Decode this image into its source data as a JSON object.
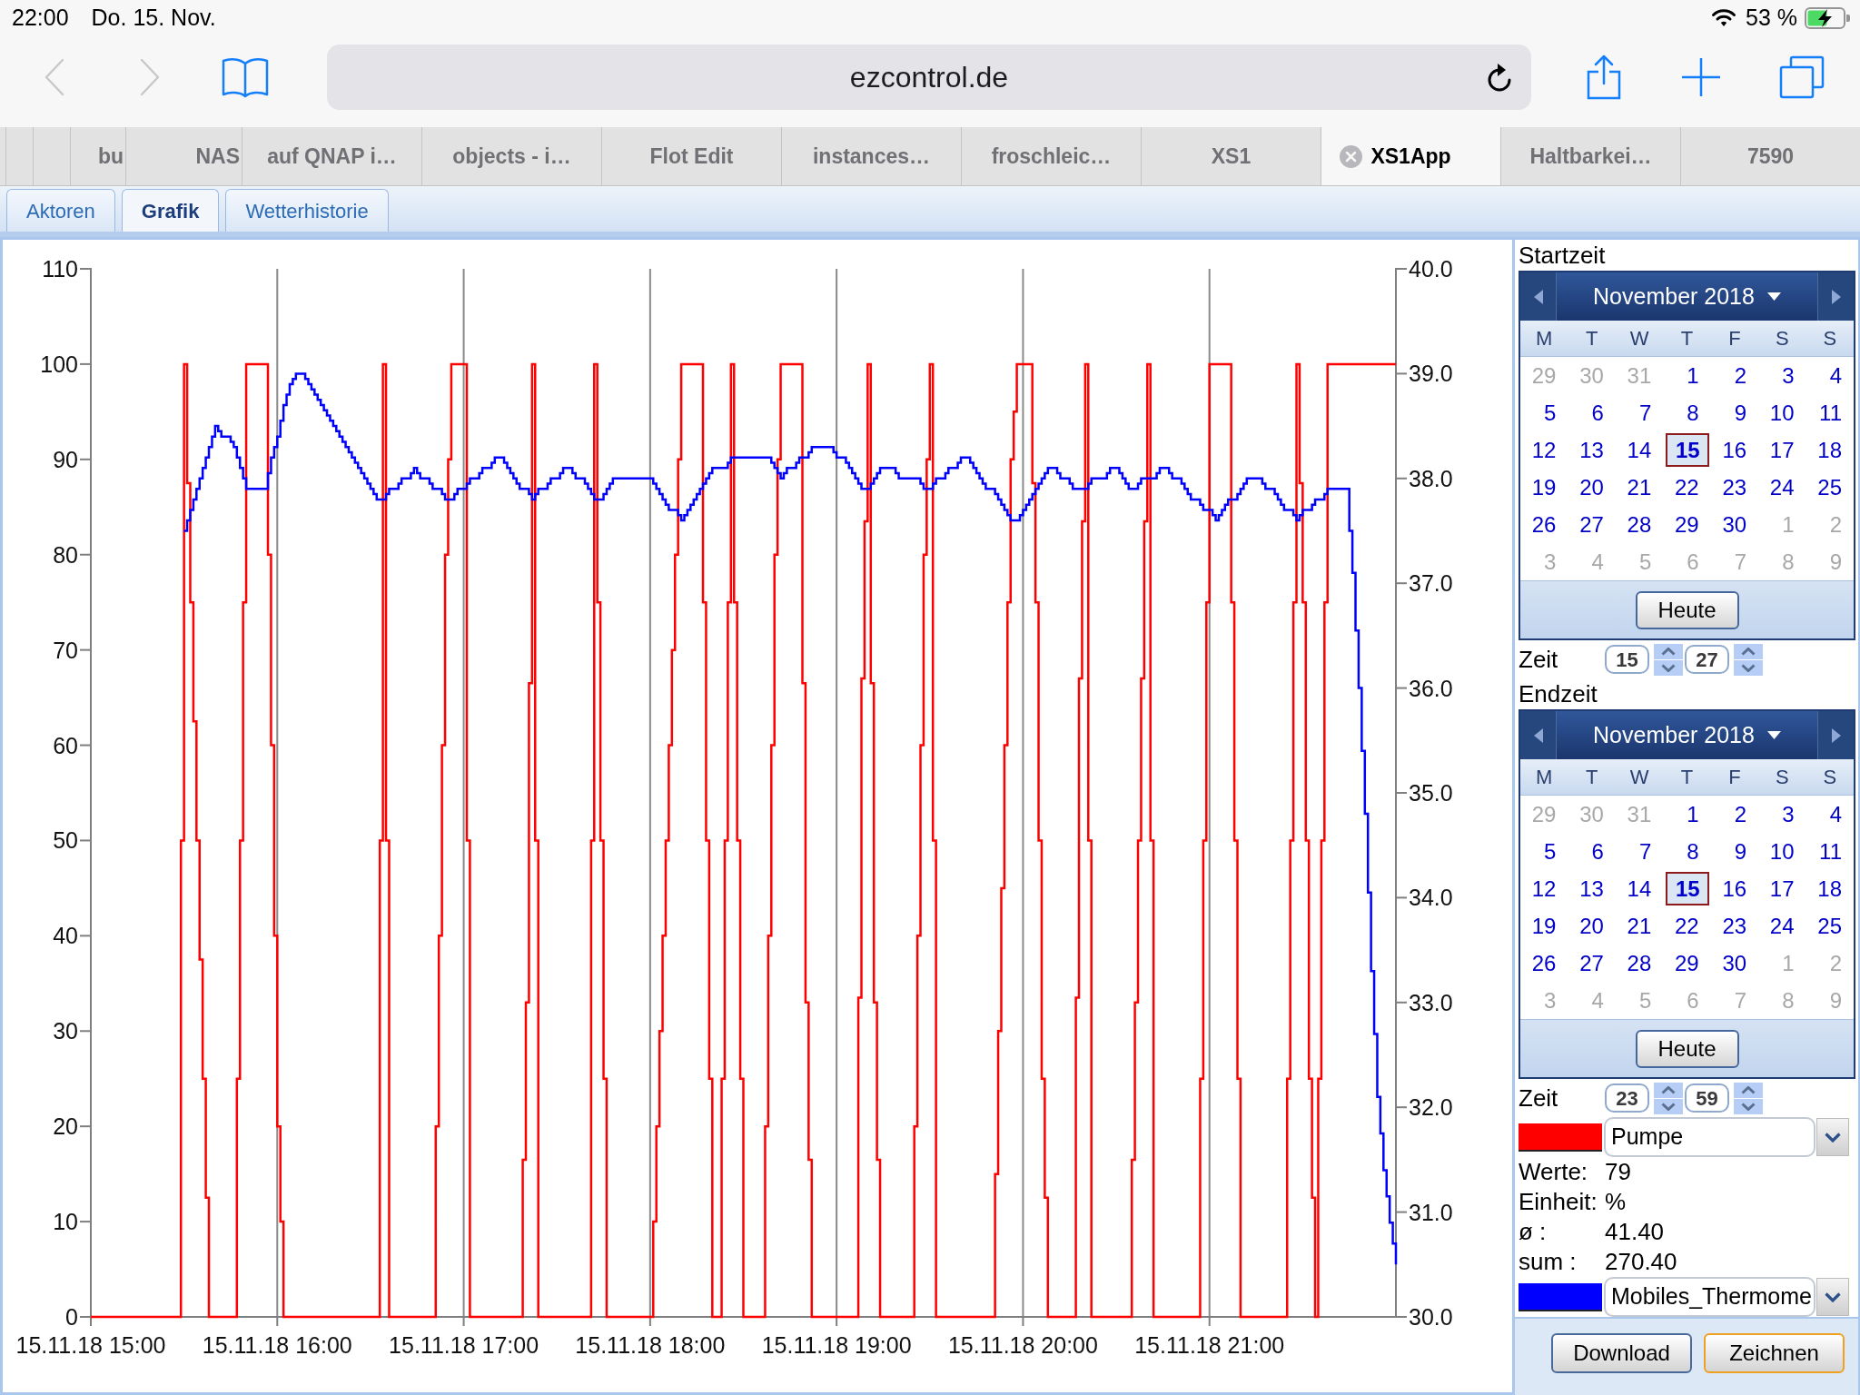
{
  "status_bar": {
    "time": "22:00",
    "date": "Do. 15. Nov.",
    "battery": "53 %"
  },
  "toolbar": {
    "nav": [
      {
        "kind": "back",
        "disabled": true
      },
      {
        "kind": "forward",
        "disabled": true
      }
    ],
    "address": "ezcontrol.de"
  },
  "browser_tabs": [
    {
      "title": "bu",
      "kind": "stacked",
      "selected": false
    },
    {
      "title": "NAS",
      "kind": "stacked",
      "selected": false
    },
    {
      "title": "auf QNAP i…",
      "kind": "full",
      "selected": false
    },
    {
      "title": "objects - i…",
      "kind": "full",
      "selected": false
    },
    {
      "title": "Flot Edit",
      "kind": "full",
      "selected": false
    },
    {
      "title": "instances…",
      "kind": "full",
      "selected": false
    },
    {
      "title": "froschleic…",
      "kind": "full",
      "selected": false
    },
    {
      "title": "XS1",
      "kind": "full",
      "selected": false
    },
    {
      "title": "XS1App",
      "kind": "full",
      "selected": true
    },
    {
      "title": "Haltbarkei…",
      "kind": "full",
      "selected": false
    },
    {
      "title": "7590",
      "kind": "full",
      "selected": false
    }
  ],
  "app_tabs": [
    {
      "label": "Aktoren",
      "selected": false
    },
    {
      "label": "Grafik",
      "selected": true
    },
    {
      "label": "Wetterhistorie",
      "selected": false
    }
  ],
  "chart": {
    "chart_data": {
      "type": "line",
      "categories": [
        "15.11.18 15:00",
        null,
        null,
        null,
        null,
        null,
        null,
        null,
        null,
        null,
        null,
        null,
        null,
        null,
        null,
        null,
        null,
        null,
        null,
        null,
        null,
        null,
        null,
        null,
        null,
        null,
        null,
        null,
        null,
        null,
        "15.11.18 16:00",
        null,
        null,
        null,
        null,
        null,
        null,
        null,
        null,
        null,
        null,
        null,
        null,
        null,
        null,
        null,
        null,
        null,
        null,
        null,
        null,
        null,
        null,
        null,
        null,
        null,
        null,
        null,
        null,
        null,
        "15.11.18 17:00",
        null,
        null,
        null,
        null,
        null,
        null,
        null,
        null,
        null,
        null,
        null,
        null,
        null,
        null,
        null,
        null,
        null,
        null,
        null,
        null,
        null,
        null,
        null,
        null,
        null,
        null,
        null,
        null,
        null,
        "15.11.18 18:00",
        null,
        null,
        null,
        null,
        null,
        null,
        null,
        null,
        null,
        null,
        null,
        null,
        null,
        null,
        null,
        null,
        null,
        null,
        null,
        null,
        null,
        null,
        null,
        null,
        null,
        null,
        null,
        null,
        null,
        "15.11.18 19:00",
        null,
        null,
        null,
        null,
        null,
        null,
        null,
        null,
        null,
        null,
        null,
        null,
        null,
        null,
        null,
        null,
        null,
        null,
        null,
        null,
        null,
        null,
        null,
        null,
        null,
        null,
        null,
        null,
        null,
        "15.11.18 20:00",
        null,
        null,
        null,
        null,
        null,
        null,
        null,
        null,
        null,
        null,
        null,
        null,
        null,
        null,
        null,
        null,
        null,
        null,
        null,
        null,
        null,
        null,
        null,
        null,
        null,
        null,
        null,
        null,
        null,
        "15.11.18 21:00",
        null,
        null,
        null,
        null,
        null,
        null,
        null,
        null,
        null,
        null,
        null,
        null,
        null,
        null,
        null,
        null,
        null,
        null,
        null,
        null,
        null,
        null,
        null,
        null,
        null,
        null,
        null,
        null,
        null,
        null
      ],
      "ylim": [
        0,
        110
      ],
      "yticks": [
        0,
        10,
        20,
        30,
        40,
        50,
        60,
        70,
        80,
        90,
        100,
        110
      ],
      "y2lim": [
        30,
        40
      ],
      "y2ticks": [
        {
          "value": 30,
          "label": "30.0"
        },
        {
          "value": 31,
          "label": "31.0"
        },
        {
          "value": 32,
          "label": "32.0"
        },
        {
          "value": 33,
          "label": "33.0"
        },
        {
          "value": 34,
          "label": "34.0"
        },
        {
          "value": 35,
          "label": "35.0"
        },
        {
          "value": 36,
          "label": "36.0"
        },
        {
          "value": 37,
          "label": "37.0"
        },
        {
          "value": 38,
          "label": "38.0"
        },
        {
          "value": 39,
          "label": "39.0"
        },
        {
          "value": 40,
          "label": "40.0"
        }
      ],
      "series": [
        {
          "color": "#ff0000",
          "values": [
            0,
            0,
            0,
            0,
            0,
            0,
            0,
            0,
            0,
            0,
            0,
            0,
            0,
            0,
            0,
            100,
            75,
            50,
            25,
            0,
            0,
            0,
            0,
            0,
            50,
            100,
            100,
            100,
            100,
            60,
            20,
            0,
            0,
            0,
            0,
            0,
            0,
            0,
            0,
            0,
            0,
            0,
            0,
            0,
            0,
            0,
            0,
            100,
            0,
            0,
            0,
            0,
            0,
            0,
            0,
            0,
            40,
            80,
            100,
            100,
            100,
            0,
            0,
            0,
            0,
            0,
            0,
            0,
            0,
            0,
            33,
            100,
            0,
            0,
            0,
            0,
            0,
            0,
            0,
            0,
            0,
            100,
            50,
            0,
            0,
            0,
            0,
            0,
            0,
            0,
            0,
            20,
            40,
            60,
            80,
            100,
            100,
            100,
            100,
            50,
            0,
            0,
            50,
            100,
            50,
            0,
            0,
            0,
            0,
            40,
            80,
            100,
            100,
            100,
            100,
            33,
            0,
            0,
            0,
            0,
            0,
            0,
            0,
            0,
            67,
            100,
            33,
            0,
            0,
            0,
            0,
            0,
            0,
            40,
            80,
            100,
            0,
            0,
            0,
            0,
            0,
            0,
            0,
            0,
            0,
            0,
            30,
            60,
            90,
            100,
            100,
            100,
            75,
            25,
            0,
            0,
            0,
            0,
            0,
            67,
            100,
            0,
            0,
            0,
            0,
            0,
            0,
            0,
            33,
            67,
            100,
            0,
            0,
            0,
            0,
            0,
            0,
            0,
            0,
            50,
            100,
            100,
            100,
            100,
            50,
            0,
            0,
            0,
            0,
            0,
            0,
            0,
            0,
            50,
            100,
            75,
            25,
            0,
            50,
            100,
            100,
            100,
            100,
            100,
            100,
            100,
            100,
            100,
            100,
            100,
            100
          ]
        },
        {
          "color": "#0000ff",
          "axis": "y2",
          "values": [
            null,
            null,
            null,
            null,
            null,
            null,
            null,
            null,
            null,
            null,
            null,
            null,
            null,
            null,
            null,
            37.5,
            37.7,
            37.9,
            38.1,
            38.3,
            38.5,
            38.4,
            38.4,
            38.3,
            38.1,
            37.9,
            37.9,
            37.9,
            37.9,
            38.2,
            38.4,
            38.7,
            38.9,
            39.0,
            39.0,
            38.9,
            38.8,
            38.7,
            38.6,
            38.5,
            38.4,
            38.3,
            38.2,
            38.1,
            38.0,
            37.9,
            37.8,
            37.8,
            37.9,
            37.9,
            38.0,
            38.0,
            38.1,
            38.0,
            38.0,
            37.9,
            37.9,
            37.8,
            37.8,
            37.9,
            37.9,
            38.0,
            38.0,
            38.1,
            38.1,
            38.2,
            38.2,
            38.1,
            38.0,
            37.9,
            37.9,
            37.8,
            37.9,
            37.9,
            38.0,
            38.0,
            38.1,
            38.1,
            38.0,
            38.0,
            37.9,
            37.8,
            37.8,
            37.9,
            38.0,
            38.0,
            38.0,
            38.0,
            38.0,
            38.0,
            38.0,
            37.9,
            37.8,
            37.7,
            37.7,
            37.6,
            37.7,
            37.8,
            37.9,
            38.0,
            38.1,
            38.1,
            38.1,
            38.2,
            38.2,
            38.2,
            38.2,
            38.2,
            38.2,
            38.2,
            38.1,
            38.0,
            38.1,
            38.1,
            38.2,
            38.2,
            38.3,
            38.3,
            38.3,
            38.3,
            38.2,
            38.2,
            38.1,
            38.0,
            37.9,
            37.9,
            38.0,
            38.1,
            38.1,
            38.1,
            38.0,
            38.0,
            38.0,
            38.0,
            37.9,
            37.9,
            38.0,
            38.0,
            38.1,
            38.1,
            38.2,
            38.2,
            38.1,
            38.0,
            37.9,
            37.9,
            37.8,
            37.7,
            37.6,
            37.6,
            37.7,
            37.8,
            37.9,
            38.0,
            38.1,
            38.1,
            38.0,
            38.0,
            37.9,
            37.9,
            37.9,
            38.0,
            38.0,
            38.0,
            38.1,
            38.1,
            38.0,
            37.9,
            37.9,
            38.0,
            38.0,
            38.0,
            38.1,
            38.1,
            38.0,
            38.0,
            37.9,
            37.8,
            37.8,
            37.7,
            37.7,
            37.6,
            37.7,
            37.8,
            37.8,
            37.9,
            38.0,
            38.0,
            38.0,
            37.9,
            37.9,
            37.8,
            37.7,
            37.7,
            37.6,
            37.7,
            37.7,
            37.8,
            37.8,
            37.9,
            37.9,
            37.9,
            37.9,
            37.1,
            36.0,
            34.8,
            33.3,
            32.1,
            31.4,
            30.9,
            30.5
          ]
        }
      ]
    }
  },
  "side_panel": {
    "ranges": [
      {
        "label": "Startzeit",
        "calendar": {
          "month": "November 2018",
          "weekdays": [
            "M",
            "T",
            "W",
            "T",
            "F",
            "S",
            "S"
          ],
          "weeks": [
            [
              {
                "day": "29",
                "outside": true,
                "selected": false
              },
              {
                "day": "30",
                "outside": true,
                "selected": false
              },
              {
                "day": "31",
                "outside": true,
                "selected": false
              },
              {
                "day": "1",
                "outside": false,
                "selected": false
              },
              {
                "day": "2",
                "outside": false,
                "selected": false
              },
              {
                "day": "3",
                "outside": false,
                "selected": false
              },
              {
                "day": "4",
                "outside": false,
                "selected": false
              }
            ],
            [
              {
                "day": "5",
                "outside": false,
                "selected": false
              },
              {
                "day": "6",
                "outside": false,
                "selected": false
              },
              {
                "day": "7",
                "outside": false,
                "selected": false
              },
              {
                "day": "8",
                "outside": false,
                "selected": false
              },
              {
                "day": "9",
                "outside": false,
                "selected": false
              },
              {
                "day": "10",
                "outside": false,
                "selected": false
              },
              {
                "day": "11",
                "outside": false,
                "selected": false
              }
            ],
            [
              {
                "day": "12",
                "outside": false,
                "selected": false
              },
              {
                "day": "13",
                "outside": false,
                "selected": false
              },
              {
                "day": "14",
                "outside": false,
                "selected": false
              },
              {
                "day": "15",
                "outside": false,
                "selected": true
              },
              {
                "day": "16",
                "outside": false,
                "selected": false
              },
              {
                "day": "17",
                "outside": false,
                "selected": false
              },
              {
                "day": "18",
                "outside": false,
                "selected": false
              }
            ],
            [
              {
                "day": "19",
                "outside": false,
                "selected": false
              },
              {
                "day": "20",
                "outside": false,
                "selected": false
              },
              {
                "day": "21",
                "outside": false,
                "selected": false
              },
              {
                "day": "22",
                "outside": false,
                "selected": false
              },
              {
                "day": "23",
                "outside": false,
                "selected": false
              },
              {
                "day": "24",
                "outside": false,
                "selected": false
              },
              {
                "day": "25",
                "outside": false,
                "selected": false
              }
            ],
            [
              {
                "day": "26",
                "outside": false,
                "selected": false
              },
              {
                "day": "27",
                "outside": false,
                "selected": false
              },
              {
                "day": "28",
                "outside": false,
                "selected": false
              },
              {
                "day": "29",
                "outside": false,
                "selected": false
              },
              {
                "day": "30",
                "outside": false,
                "selected": false
              },
              {
                "day": "1",
                "outside": true,
                "selected": false
              },
              {
                "day": "2",
                "outside": true,
                "selected": false
              }
            ],
            [
              {
                "day": "3",
                "outside": true,
                "selected": false
              },
              {
                "day": "4",
                "outside": true,
                "selected": false
              },
              {
                "day": "5",
                "outside": true,
                "selected": false
              },
              {
                "day": "6",
                "outside": true,
                "selected": false
              },
              {
                "day": "7",
                "outside": true,
                "selected": false
              },
              {
                "day": "8",
                "outside": true,
                "selected": false
              },
              {
                "day": "9",
                "outside": true,
                "selected": false
              }
            ]
          ],
          "today_button": "Heute"
        },
        "time": {
          "label": "Zeit",
          "hour": "15",
          "minute": "27"
        }
      },
      {
        "label": "Endzeit",
        "calendar": {
          "month": "November 2018",
          "weekdays": [
            "M",
            "T",
            "W",
            "T",
            "F",
            "S",
            "S"
          ],
          "weeks": [
            [
              {
                "day": "29",
                "outside": true,
                "selected": false
              },
              {
                "day": "30",
                "outside": true,
                "selected": false
              },
              {
                "day": "31",
                "outside": true,
                "selected": false
              },
              {
                "day": "1",
                "outside": false,
                "selected": false
              },
              {
                "day": "2",
                "outside": false,
                "selected": false
              },
              {
                "day": "3",
                "outside": false,
                "selected": false
              },
              {
                "day": "4",
                "outside": false,
                "selected": false
              }
            ],
            [
              {
                "day": "5",
                "outside": false,
                "selected": false
              },
              {
                "day": "6",
                "outside": false,
                "selected": false
              },
              {
                "day": "7",
                "outside": false,
                "selected": false
              },
              {
                "day": "8",
                "outside": false,
                "selected": false
              },
              {
                "day": "9",
                "outside": false,
                "selected": false
              },
              {
                "day": "10",
                "outside": false,
                "selected": false
              },
              {
                "day": "11",
                "outside": false,
                "selected": false
              }
            ],
            [
              {
                "day": "12",
                "outside": false,
                "selected": false
              },
              {
                "day": "13",
                "outside": false,
                "selected": false
              },
              {
                "day": "14",
                "outside": false,
                "selected": false
              },
              {
                "day": "15",
                "outside": false,
                "selected": true
              },
              {
                "day": "16",
                "outside": false,
                "selected": false
              },
              {
                "day": "17",
                "outside": false,
                "selected": false
              },
              {
                "day": "18",
                "outside": false,
                "selected": false
              }
            ],
            [
              {
                "day": "19",
                "outside": false,
                "selected": false
              },
              {
                "day": "20",
                "outside": false,
                "selected": false
              },
              {
                "day": "21",
                "outside": false,
                "selected": false
              },
              {
                "day": "22",
                "outside": false,
                "selected": false
              },
              {
                "day": "23",
                "outside": false,
                "selected": false
              },
              {
                "day": "24",
                "outside": false,
                "selected": false
              },
              {
                "day": "25",
                "outside": false,
                "selected": false
              }
            ],
            [
              {
                "day": "26",
                "outside": false,
                "selected": false
              },
              {
                "day": "27",
                "outside": false,
                "selected": false
              },
              {
                "day": "28",
                "outside": false,
                "selected": false
              },
              {
                "day": "29",
                "outside": false,
                "selected": false
              },
              {
                "day": "30",
                "outside": false,
                "selected": false
              },
              {
                "day": "1",
                "outside": true,
                "selected": false
              },
              {
                "day": "2",
                "outside": true,
                "selected": false
              }
            ],
            [
              {
                "day": "3",
                "outside": true,
                "selected": false
              },
              {
                "day": "4",
                "outside": true,
                "selected": false
              },
              {
                "day": "5",
                "outside": true,
                "selected": false
              },
              {
                "day": "6",
                "outside": true,
                "selected": false
              },
              {
                "day": "7",
                "outside": true,
                "selected": false
              },
              {
                "day": "8",
                "outside": true,
                "selected": false
              },
              {
                "day": "9",
                "outside": true,
                "selected": false
              }
            ]
          ],
          "today_button": "Heute"
        },
        "time": {
          "label": "Zeit",
          "hour": "23",
          "minute": "59"
        }
      }
    ],
    "series": [
      {
        "color": "#ff0000",
        "name": "Pumpe",
        "stats": [
          {
            "label": "Werte:",
            "value": "79"
          },
          {
            "label": "Einheit:",
            "value": "%"
          },
          {
            "label": "ø :",
            "value": "41.40"
          },
          {
            "label": "sum :",
            "value": "270.40"
          }
        ]
      },
      {
        "color": "#0000ff",
        "name": "Mobiles_Thermome"
      }
    ],
    "buttons": [
      {
        "label": "Download",
        "focused": false
      },
      {
        "label": "Zeichnen",
        "focused": true
      }
    ]
  }
}
